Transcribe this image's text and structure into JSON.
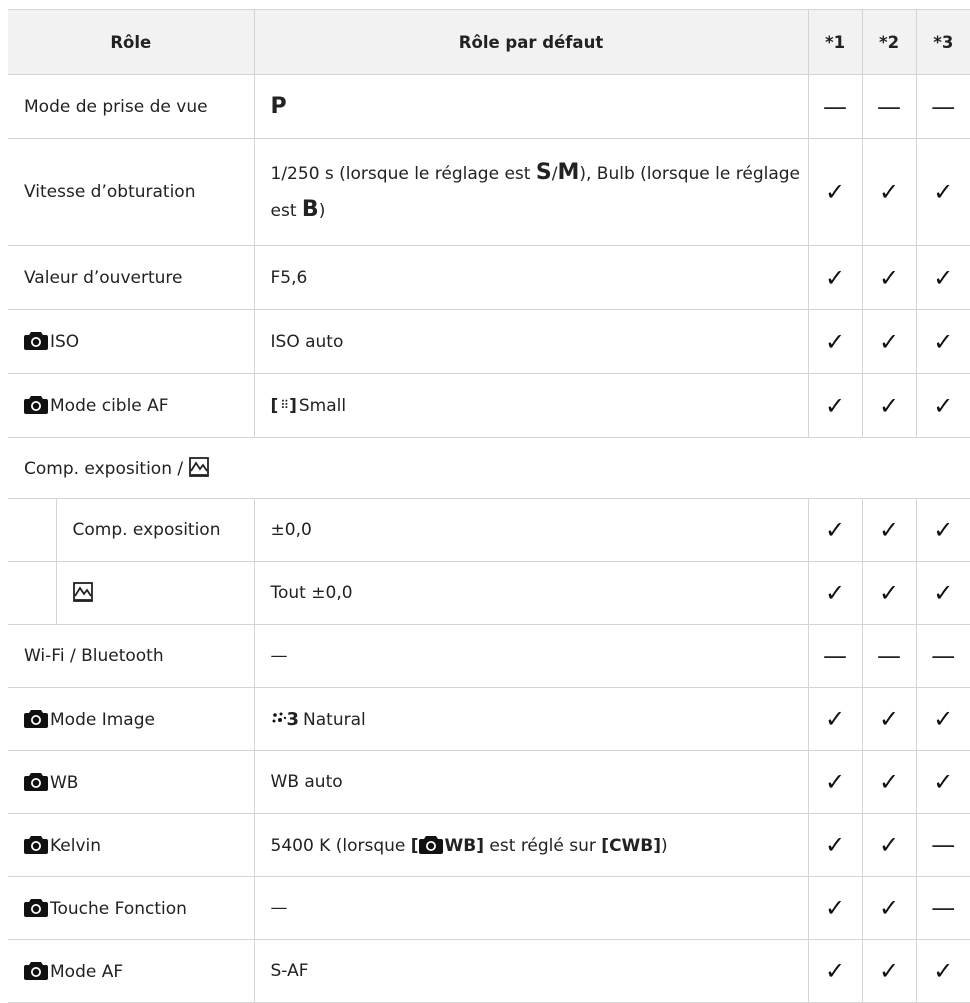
{
  "headers": {
    "role": "Rôle",
    "default": "Rôle par défaut",
    "c1": "*1",
    "c2": "*2",
    "c3": "*3"
  },
  "marks": {
    "check": "✓",
    "dash": "—"
  },
  "rows": {
    "mode": {
      "name": "Mode de prise de vue",
      "value": "P"
    },
    "shutter": {
      "name": "Vitesse d’obturation",
      "v1": "1/250 s (lorsque le réglage est ",
      "vS": "S",
      "vslash": "/",
      "vM": "M",
      "v2": "), Bulb (lorsque le réglage est ",
      "vB": "B",
      "v3": ")"
    },
    "aperture": {
      "name": "Valeur d’ouverture",
      "value": "F5,6"
    },
    "iso": {
      "name": "ISO",
      "value": "ISO auto"
    },
    "aftarget": {
      "name": "Mode cible AF",
      "frame_open": "[",
      "frame_glyph": "⠿",
      "frame_close": "]",
      "value": "Small"
    },
    "expcomp_section": {
      "name": "Comp. exposition / "
    },
    "expcomp": {
      "name": "Comp. exposition",
      "value": "±0,0"
    },
    "ev_sub": {
      "value": "Tout ±0,0"
    },
    "wifi": {
      "name": "Wi-Fi / Bluetooth",
      "value": "—"
    },
    "picmode": {
      "name": "Mode Image",
      "pm_num": "3",
      "value": "Natural"
    },
    "wb": {
      "name": "WB",
      "value": "WB auto"
    },
    "kelvin": {
      "name": "Kelvin",
      "v1": "5400 K (lorsque ",
      "v2": "[",
      "v3": "WB]",
      "v4": " est réglé sur ",
      "v5": "[CWB]",
      "v6": ")"
    },
    "fn": {
      "name": "Touche Fonction",
      "value": "—"
    },
    "afmode": {
      "name": "Mode AF",
      "value": "S-AF"
    }
  }
}
